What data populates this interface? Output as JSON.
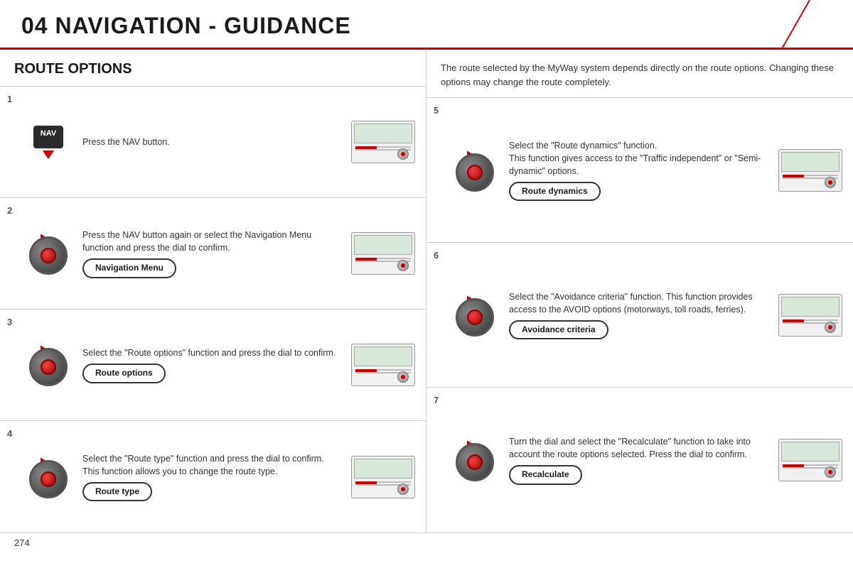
{
  "header": {
    "title": "04  NAVIGATION - GUIDANCE"
  },
  "left": {
    "section_title": "ROUTE OPTIONS",
    "steps": [
      {
        "number": "1",
        "description": "Press the NAV button.",
        "icon_type": "nav_button",
        "has_pill": false,
        "pill_label": ""
      },
      {
        "number": "2",
        "description": "Press the NAV button again or select the Navigation Menu function and press the dial to confirm.",
        "icon_type": "dial",
        "has_pill": true,
        "pill_label": "Navigation Menu"
      },
      {
        "number": "3",
        "description": "Select the \"Route options\" function and press the dial to confirm.",
        "icon_type": "dial",
        "has_pill": true,
        "pill_label": "Route options"
      },
      {
        "number": "4",
        "description": "Select the \"Route type\" function and press the dial to confirm. This function allows you to change the route type.",
        "icon_type": "dial",
        "has_pill": true,
        "pill_label": "Route type"
      }
    ]
  },
  "right": {
    "intro": "The route selected by the MyWay system depends directly on the route options.\nChanging these options may change the route completely.",
    "steps": [
      {
        "number": "5",
        "description": "Select the \"Route dynamics\" function.\nThis function gives access to the \"Traffic independent\" or \"Semi-dynamic\" options.",
        "icon_type": "dial",
        "has_pill": true,
        "pill_label": "Route dynamics"
      },
      {
        "number": "6",
        "description": "Select the \"Avoidance criteria\" function. This function provides access to the AVOID options (motorways, toll roads, ferries).",
        "icon_type": "dial",
        "has_pill": true,
        "pill_label": "Avoidance criteria"
      },
      {
        "number": "7",
        "description": "Turn the dial and select the \"Recalculate\" function to take into account the route options selected. Press the dial to confirm.",
        "icon_type": "dial",
        "has_pill": true,
        "pill_label": "Recalculate"
      }
    ]
  },
  "footer": {
    "page_number": "274"
  }
}
